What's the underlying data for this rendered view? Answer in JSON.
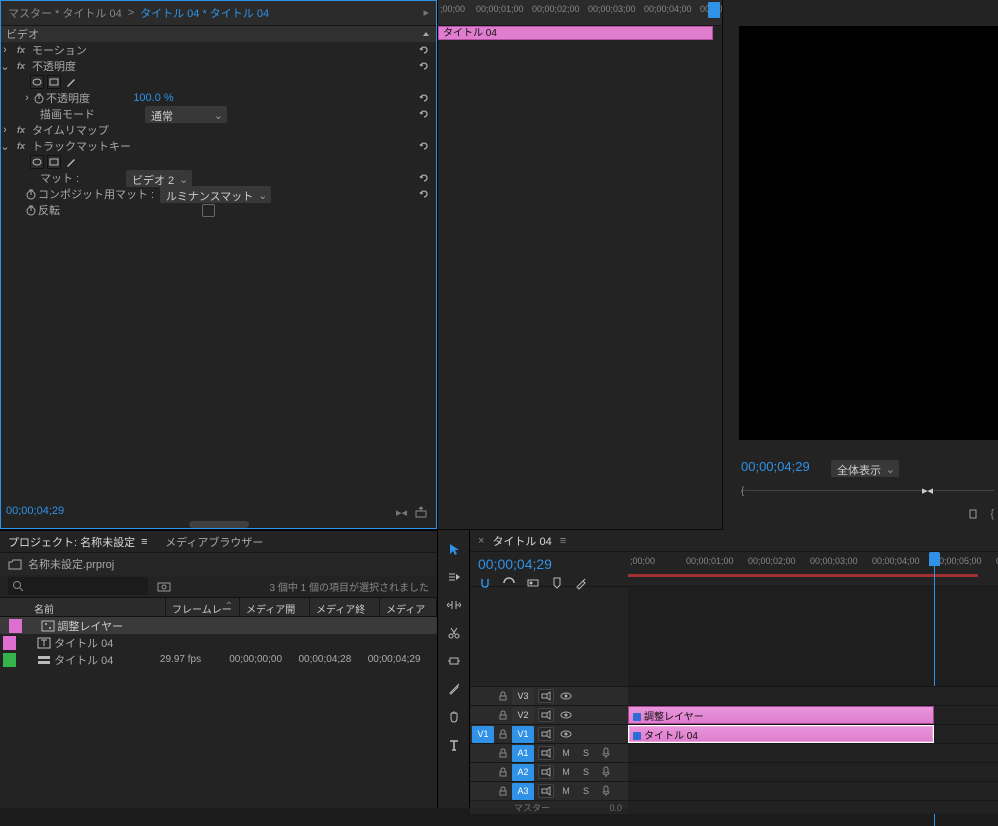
{
  "fx": {
    "master_label": "マスター * タイトル 04",
    "clip_label": "タイトル 04 * タイトル 04",
    "section_video": "ビデオ",
    "motion": "モーション",
    "opacity": "不透明度",
    "opacity_prop": "不透明度",
    "opacity_value": "100.0 %",
    "blend_mode_label": "描画モード",
    "blend_mode_value": "通常",
    "timeremap": "タイムリマップ",
    "trackmatte": "トラックマットキー",
    "matte_label": "マット :",
    "matte_value": "ビデオ 2",
    "composite_label": "コンポジット用マット :",
    "composite_value": "ルミナンスマット",
    "reverse_label": "反転",
    "tc": "00;00;04;29",
    "ruler": [
      ";00;00",
      "00;00;01;00",
      "00;00;02;00",
      "00;00;03;00",
      "00;00;04;00",
      "00;00"
    ],
    "tl_clip": "タイトル 04"
  },
  "monitor": {
    "tc": "00;00;04;29",
    "zoom": "全体表示"
  },
  "project": {
    "tab1": "プロジェクト: 名称未設定",
    "tab2": "メディアブラウザー",
    "bin_name": "名称未設定.prproj",
    "selection_text": "3 個中 1 個の項目が選択されました",
    "cols": {
      "name": "名前",
      "fr": "フレームレート",
      "ms": "メディア開始",
      "me": "メディア終了",
      "md": "メディアデュ"
    },
    "items": [
      {
        "lab": "#de6fd0",
        "name": "調整レイヤー",
        "fr": "",
        "ms": "",
        "me": "",
        "md": "",
        "icon": "adjust"
      },
      {
        "lab": "#de6fd0",
        "name": "タイトル 04",
        "fr": "",
        "ms": "",
        "me": "",
        "md": "",
        "icon": "title"
      },
      {
        "lab": "#36b24a",
        "name": "タイトル 04",
        "fr": "29.97 fps",
        "ms": "00;00;00;00",
        "me": "00;00;04;28",
        "md": "00;00;04;29",
        "icon": "seq"
      }
    ]
  },
  "timeline": {
    "tab": "タイトル 04",
    "tc": "00;00;04;29",
    "ruler": [
      ";00;00",
      "00;00;01;00",
      "00;00;02;00",
      "00;00;03;00",
      "00;00;04;00",
      "00;00;05;00",
      "00"
    ],
    "video_tracks": [
      "V3",
      "V2",
      "V1"
    ],
    "audio_tracks": [
      "A1",
      "A2",
      "A3"
    ],
    "clip_v2": "調整レイヤー",
    "clip_v1": "タイトル 04",
    "master_label": "マスター",
    "master_val": "0.0"
  }
}
